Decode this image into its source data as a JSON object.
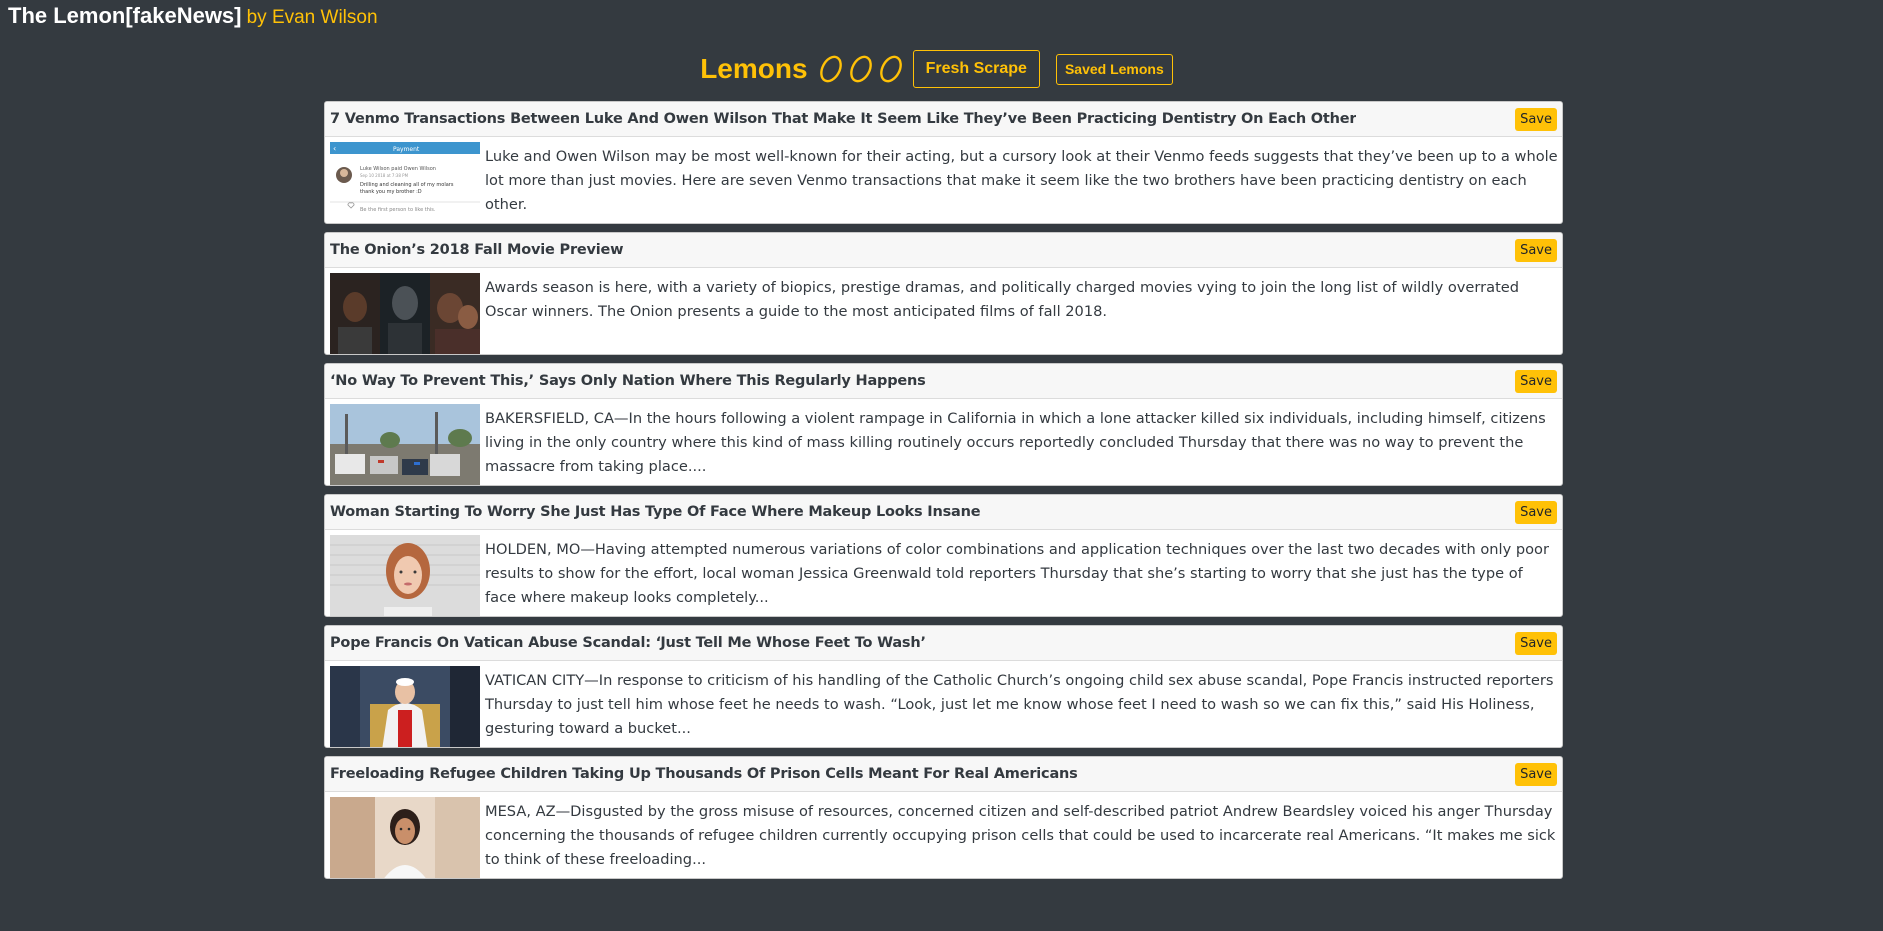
{
  "brand": {
    "title": "The Lemon[fakeNews]",
    "byline": "by Evan Wilson"
  },
  "hero": {
    "heading": "Lemons",
    "lemon_icons": [
      "lemon-icon",
      "lemon-icon",
      "lemon-icon"
    ],
    "fresh_scrape_label": "Fresh Scrape",
    "saved_lemons_label": "Saved Lemons"
  },
  "colors": {
    "background": "#343a40",
    "accent": "#ffc107",
    "card_header": "#f7f7f7"
  },
  "articles": [
    {
      "title": "7 Venmo Transactions Between Luke And Owen Wilson That Make It Seem Like They’ve Been Practicing Dentistry On Each Other",
      "summary": "Luke and Owen Wilson may be most well-known for their acting, but a cursory look at their Venmo feeds suggests that they’ve been up to a whole lot more than just movies. Here are seven Venmo transactions that make it seem like the two brothers have been practicing dentistry on each other.",
      "save_label": "Save",
      "thumb": {
        "header": "Payment",
        "payer_line": "Luke Wilson paid Owen Wilson",
        "date_line": "Sep 10 2018 at 7:38 PM",
        "note_line1": "Drilling and cleaning all of my molars",
        "note_line2": "thank you my brother :D",
        "like_line": "Be the first person to like this."
      }
    },
    {
      "title": "The Onion’s 2018 Fall Movie Preview",
      "summary": "Awards season is here, with a variety of biopics, prestige dramas, and politically charged movies vying to join the long list of wildly overrated Oscar winners. The Onion presents a guide to the most anticipated films of fall 2018.",
      "save_label": "Save"
    },
    {
      "title": "‘No Way To Prevent This,’ Says Only Nation Where This Regularly Happens",
      "summary": "BAKERSFIELD, CA—In the hours following a violent rampage in California in which a lone attacker killed six individuals, including himself, citizens living in the only country where this kind of mass killing routinely occurs reportedly concluded Thursday that there was no way to prevent the massacre from taking place....",
      "save_label": "Save"
    },
    {
      "title": "Woman Starting To Worry She Just Has Type Of Face Where Makeup Looks Insane",
      "summary": "HOLDEN, MO—Having attempted numerous variations of color combinations and application techniques over the last two decades with only poor results to show for the effort, local woman Jessica Greenwald told reporters Thursday that she’s starting to worry that she just has the type of face where makeup looks completely...",
      "save_label": "Save"
    },
    {
      "title": "Pope Francis On Vatican Abuse Scandal: ‘Just Tell Me Whose Feet To Wash’",
      "summary": "VATICAN CITY—In response to criticism of his handling of the Catholic Church’s ongoing child sex abuse scandal, Pope Francis instructed reporters Thursday to just tell him whose feet he needs to wash. “Look, just let me know whose feet I need to wash so we can fix this,” said His Holiness, gesturing toward a bucket...",
      "save_label": "Save"
    },
    {
      "title": "Freeloading Refugee Children Taking Up Thousands Of Prison Cells Meant For Real Americans",
      "summary": "MESA, AZ—Disgusted by the gross misuse of resources, concerned citizen and self-described patriot Andrew Beardsley voiced his anger Thursday concerning the thousands of refugee children currently occupying prison cells that could be used to incarcerate real Americans. “It makes me sick to think of these freeloading...",
      "save_label": "Save"
    }
  ]
}
